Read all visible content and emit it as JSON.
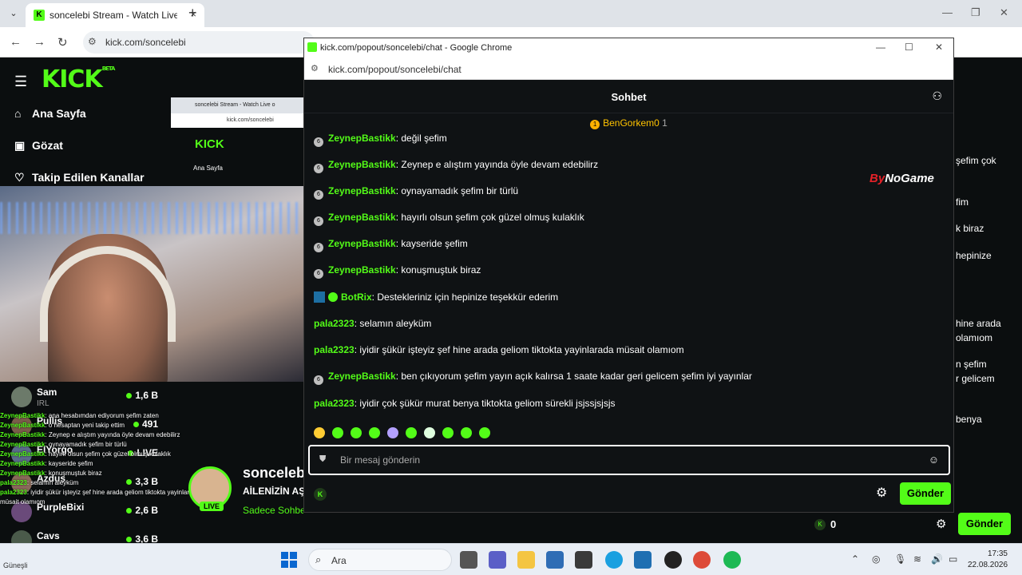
{
  "browser": {
    "tab_title": "soncelebi Stream - Watch Live o",
    "url": "kick.com/soncelebi"
  },
  "kick": {
    "logo": "KICK",
    "beta": "BETA",
    "nav": [
      {
        "label": "Ana Sayfa",
        "icon": "home-icon"
      },
      {
        "label": "Gözat",
        "icon": "browse-icon"
      },
      {
        "label": "Takip Edilen Kanallar",
        "icon": "heart-icon"
      }
    ],
    "mini_title": "soncelebi Stream - Watch Live o",
    "mini_url": "kick.com/soncelebi",
    "mini_nav": "Ana Sayfa"
  },
  "channels": [
    {
      "name": "Sam",
      "category": "IRL",
      "count": "1,6 B"
    },
    {
      "name": "Pullis",
      "category": "",
      "count": "491"
    },
    {
      "name": "ElYorgo",
      "category": "",
      "count": "LIVE"
    },
    {
      "name": "Azdus",
      "category": "",
      "count": "3,3 B"
    },
    {
      "name": "PurpleBixi",
      "category": "",
      "count": "2,6 B"
    },
    {
      "name": "Cavs",
      "category": "",
      "count": "3,6 B"
    }
  ],
  "overlay_chat": [
    {
      "user": "ZeynepBastikk",
      "text": ": ana hesabımdan ediyorum şefim zaten"
    },
    {
      "user": "ZeynepBastikk",
      "text": ": o hesaptan yeni takip ettim"
    },
    {
      "user": "ZeynepBastikk",
      "text": ": Zeynep e alıştım yayında öyle devam edebilirz"
    },
    {
      "user": "ZeynepBastikk",
      "text": ": oynayamadık şefim bir türlü"
    },
    {
      "user": "ZeynepBastikk",
      "text": ": hayırlı olsun şefim çok güzel olmuş kulaklık"
    },
    {
      "user": "ZeynepBastikk",
      "text": ": kayseride şefim"
    },
    {
      "user": "ZeynepBastikk",
      "text": ": konuşmuştuk biraz"
    },
    {
      "user": "pala2323",
      "text": ": selamın aleyküm"
    },
    {
      "user": "pala2323",
      "text": ": iyidir şükür işteyiz şef hine arada geliom tiktokta yayinlarada müsait olamıom"
    }
  ],
  "streamer": {
    "name": "soncelebi",
    "title": "AİLENİZİN AŞ",
    "subtitle": "Sadece Sohbe",
    "live": "LIVE"
  },
  "popup": {
    "window_title": "kick.com/popout/soncelebi/chat - Google Chrome",
    "url": "kick.com/popout/soncelebi/chat",
    "chat_title": "Sohbet",
    "pinned_user": "BenGorkem0",
    "pinned_count": "1",
    "watermark_a": "By",
    "watermark_b": "NoGame",
    "input_placeholder": "Bir mesaj gönderin",
    "send_label": "Gönder"
  },
  "messages": [
    {
      "user": "ZeynepBastikk",
      "text": " değil şefim",
      "badge": true
    },
    {
      "user": "ZeynepBastikk",
      "text": " Zeynep e alıştım yayında öyle devam edebilirz",
      "badge": true
    },
    {
      "user": "ZeynepBastikk",
      "text": " oynayamadık şefim bir türlü",
      "badge": true
    },
    {
      "user": "ZeynepBastikk",
      "text": " hayırlı olsun şefim çok güzel olmuş kulaklık",
      "badge": true
    },
    {
      "user": "ZeynepBastikk",
      "text": " kayseride şefim",
      "badge": true
    },
    {
      "user": "ZeynepBastikk",
      "text": " konuşmuştuk biraz",
      "badge": true
    },
    {
      "user": "BotRix",
      "text": " Destekleriniz için hepinize teşekkür ederim",
      "bot": true
    },
    {
      "user": "pala2323",
      "text": " selamın aleyküm"
    },
    {
      "user": "pala2323",
      "text": " iyidir şükür işteyiz şef hine arada geliom tiktokta yayinlarada müsait olamıom"
    },
    {
      "user": "ZeynepBastikk",
      "text": " ben çıkıyorum şefim yayın açık kalırsa 1 saate kadar geri gelicem şefim iyi yayınlar",
      "badge": true
    },
    {
      "user": "pala2323",
      "text": " iyidir çok şükür murat benya tiktokta geliom sürekli jsjssjsjsjs"
    }
  ],
  "right_peek": [
    "şefim çok",
    "fim",
    "k biraz",
    "hepinize",
    "hine arada",
    "olamıom",
    "n şefim",
    "r gelicem",
    "benya"
  ],
  "bottom": {
    "count": "0",
    "send_label": "Gönder"
  },
  "taskbar": {
    "search": "Ara",
    "time": "17:35",
    "date": "22.08.2026",
    "weather": "Güneşli"
  },
  "colors": {
    "kick_green": "#53fc18",
    "bg": "#0b0e0f"
  }
}
